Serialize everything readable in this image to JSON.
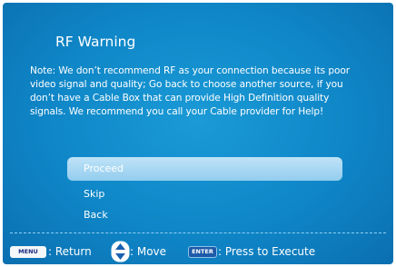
{
  "dialog": {
    "title": "RF Warning",
    "note": "Note: We don’t recommend RF as your connection because its poor video signal and quality; Go back to choose another source, if you don’t have a Cable Box that can provide High Definition quality signals. We recommend you call your Cable provider for Help!"
  },
  "menu": {
    "items": [
      {
        "label": "Proceed",
        "selected": true
      },
      {
        "label": "Skip",
        "selected": false
      },
      {
        "label": "Back",
        "selected": false
      }
    ]
  },
  "footer": {
    "menu_key": "MENU",
    "return_label": ": Return",
    "move_label": ": Move",
    "enter_key": "ENTER",
    "execute_label": ": Press to Execute"
  },
  "colors": {
    "background": "#0f86c7",
    "selected_item": "#93cdee",
    "text": "#ffffff"
  }
}
